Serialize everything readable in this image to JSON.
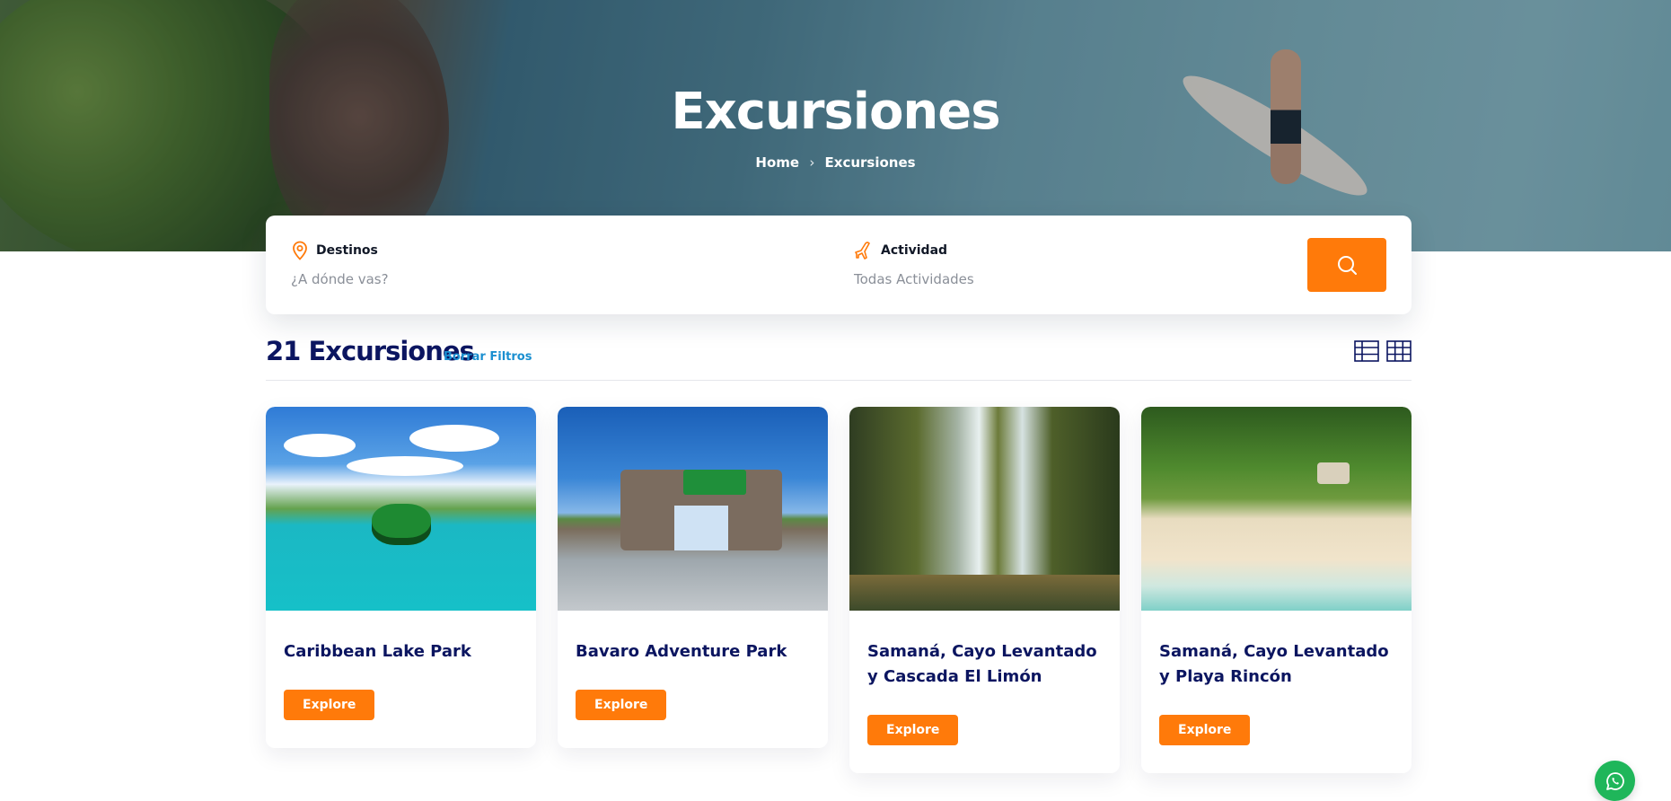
{
  "hero": {
    "title": "Excursiones",
    "breadcrumb": {
      "home": "Home",
      "current": "Excursiones"
    }
  },
  "search": {
    "destination": {
      "label": "Destinos",
      "placeholder": "¿A dónde vas?",
      "icon": "map-pin-icon"
    },
    "activity": {
      "label": "Actividad",
      "placeholder": "Todas Actividades",
      "icon": "plane-icon"
    },
    "button_icon": "search-icon"
  },
  "results": {
    "title": "21 Excursiones",
    "clear_filters": "Borrar Filtros",
    "view_icons": [
      "list-view-icon",
      "grid-view-icon"
    ]
  },
  "cards": [
    {
      "title": "Caribbean Lake Park",
      "button": "Explore"
    },
    {
      "title": "Bavaro Adventure Park",
      "button": "Explore"
    },
    {
      "title": "Samaná, Cayo Levantado y Cascada El Limón",
      "button": "Explore"
    },
    {
      "title": "Samaná, Cayo Levantado y Playa Rincón",
      "button": "Explore"
    }
  ],
  "colors": {
    "accent": "#ff7a0a",
    "heading": "#0b1560",
    "link": "#1a8fd0",
    "whatsapp": "#1fb65a"
  },
  "floating": {
    "icon": "whatsapp-icon"
  }
}
